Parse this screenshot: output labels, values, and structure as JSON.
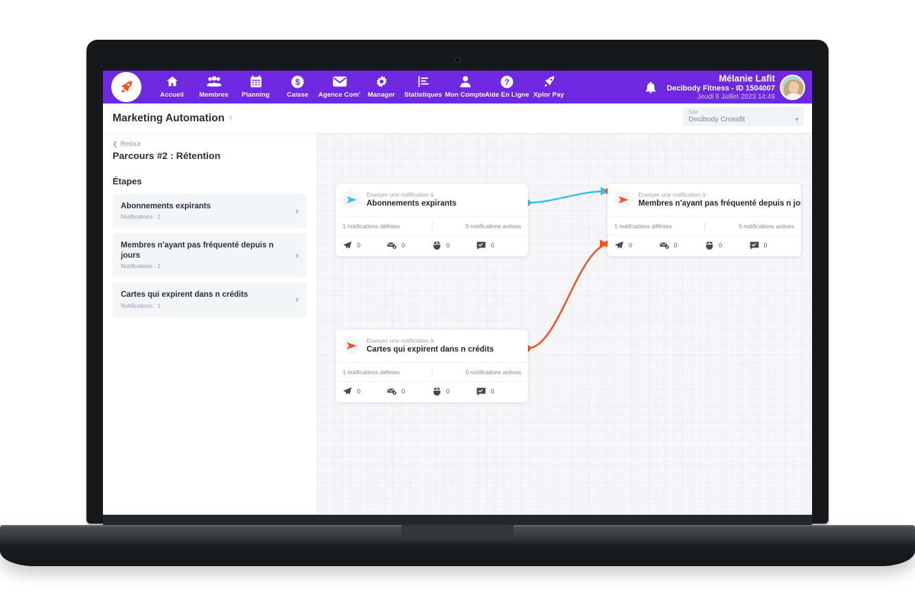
{
  "app": {
    "colors": {
      "nav_purple": "#6d28e0",
      "accent_orange": "#f4511e",
      "accent_cyan": "#2ec4ea",
      "canvas_bg": "#f6f6f8"
    }
  },
  "topnav": {
    "logo_icon": "rocket-icon",
    "items": [
      {
        "label": "Accueil",
        "icon": "home-icon"
      },
      {
        "label": "Membres",
        "icon": "users-icon"
      },
      {
        "label": "Planning",
        "icon": "calendar-icon"
      },
      {
        "label": "Caisse",
        "icon": "dollar-circle-icon"
      },
      {
        "label": "Agence Com'",
        "icon": "envelope-icon"
      },
      {
        "label": "Manager",
        "icon": "gear-icon"
      },
      {
        "label": "Statistiques",
        "icon": "bar-chart-icon"
      },
      {
        "label": "Mon Compte",
        "icon": "person-icon"
      },
      {
        "label": "Aide En Ligne",
        "icon": "question-circle-icon"
      },
      {
        "label": "Xplor Pay",
        "icon": "rocket-icon"
      }
    ],
    "bell_icon": "bell-icon",
    "user": {
      "name": "Mélanie Lafit",
      "org": "Decibody Fitness  - ID 1504007",
      "date": "Jeudi 6 Juillet 2023 14:49",
      "avatar_icon": "avatar"
    }
  },
  "page_header": {
    "title": "Marketing Automation",
    "help_icon": "question-mark-icon",
    "site": {
      "label": "Site",
      "value": "Decibody Crossfit",
      "caret_icon": "chevron-down-icon"
    }
  },
  "sidebar": {
    "back": {
      "label": "Retour",
      "icon": "chevron-left-icon"
    },
    "parcours_title": "Parcours #2 : Rétention",
    "etapes_heading": "Étapes",
    "steps": [
      {
        "name": "Abonnements expirants",
        "sub": "Notifications : 1",
        "chevron_icon": "chevron-right-icon"
      },
      {
        "name": "Membres n'ayant pas fréquenté depuis n jours",
        "sub": "Notifications : 1",
        "chevron_icon": "chevron-right-icon"
      },
      {
        "name": "Cartes qui expirent dans n crédits",
        "sub": "Notifications : 1",
        "chevron_icon": "chevron-right-icon"
      }
    ]
  },
  "canvas": {
    "nodes": [
      {
        "kicker": "Envoyer une notification à",
        "title": "Abonnements expirants",
        "send_icon": "send-arrow-icon",
        "send_color": "#2ec4ea",
        "stat_defined": "1 notifications définies",
        "stat_active": "0 notifications actives",
        "metrics": [
          {
            "icon": "paper-plane-icon",
            "value": "0"
          },
          {
            "icon": "envelope-opened-icon",
            "value": "0"
          },
          {
            "icon": "mouse-click-icon",
            "value": "0"
          },
          {
            "icon": "comment-check-icon",
            "value": "0"
          }
        ]
      },
      {
        "kicker": "Envoyer une notification à",
        "title": "Membres n'ayant pas fréquenté depuis n jours",
        "send_icon": "send-arrow-icon",
        "send_color": "#f4511e",
        "stat_defined": "1 notifications définies",
        "stat_active": "0 notifications actives",
        "metrics": [
          {
            "icon": "paper-plane-icon",
            "value": "0"
          },
          {
            "icon": "envelope-opened-icon",
            "value": "0"
          },
          {
            "icon": "mouse-click-icon",
            "value": "0"
          },
          {
            "icon": "comment-check-icon",
            "value": "0"
          }
        ]
      },
      {
        "kicker": "Envoyer une notification à",
        "title": "Cartes qui expirent dans n crédits",
        "send_icon": "send-arrow-icon",
        "send_color": "#f4511e",
        "stat_defined": "1 notifications définies",
        "stat_active": "0 notifications actives",
        "metrics": [
          {
            "icon": "paper-plane-icon",
            "value": "0"
          },
          {
            "icon": "envelope-opened-icon",
            "value": "0"
          },
          {
            "icon": "mouse-click-icon",
            "value": "0"
          },
          {
            "icon": "comment-check-icon",
            "value": "0"
          }
        ]
      }
    ],
    "edges": [
      {
        "from": "Abonnements expirants",
        "to": "Membres n'ayant pas fréquenté depuis n jours",
        "color": "#2ec4ea"
      },
      {
        "from": "Cartes qui expirent dans n crédits",
        "to": "Membres n'ayant pas fréquenté depuis n jours",
        "color": "#f4511e"
      }
    ]
  }
}
